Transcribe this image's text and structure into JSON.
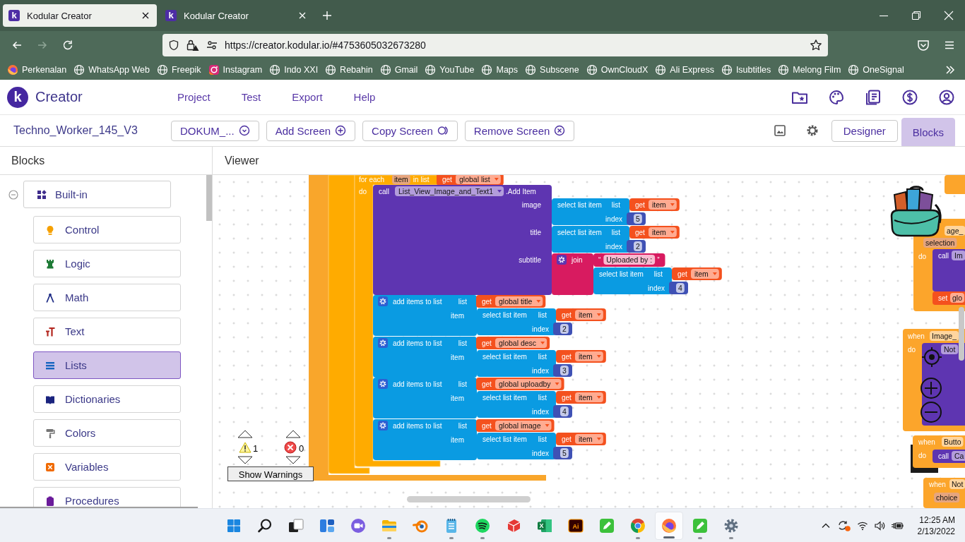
{
  "browser": {
    "tabs": [
      {
        "icon_letter": "k",
        "title": "Kodular Creator",
        "selected": true
      },
      {
        "icon_letter": "k",
        "title": "Kodular Creator",
        "selected": false
      }
    ],
    "url": "https://creator.kodular.io/#4753605032673280",
    "bookmarks": [
      {
        "label": "Perkenalan",
        "kind": "firefox"
      },
      {
        "label": "WhatsApp Web",
        "kind": "globe"
      },
      {
        "label": "Freepik",
        "kind": "globe"
      },
      {
        "label": "Instagram",
        "kind": "instagram"
      },
      {
        "label": "Indo XXI",
        "kind": "globe"
      },
      {
        "label": "Rebahin",
        "kind": "globe"
      },
      {
        "label": "Gmail",
        "kind": "globe"
      },
      {
        "label": "YouTube",
        "kind": "globe"
      },
      {
        "label": "Maps",
        "kind": "globe"
      },
      {
        "label": "Subscene",
        "kind": "globe"
      },
      {
        "label": "OwnCloudX",
        "kind": "globe"
      },
      {
        "label": "Ali Express",
        "kind": "globe"
      },
      {
        "label": "Isubtitles",
        "kind": "globe"
      },
      {
        "label": "Melong Film",
        "kind": "globe"
      },
      {
        "label": "OneSignal",
        "kind": "globe"
      }
    ]
  },
  "app": {
    "logo_letter": "k",
    "brand": "Creator",
    "menu": [
      "Project",
      "Test",
      "Export",
      "Help"
    ]
  },
  "toolbar": {
    "project": "Techno_Worker_145_V3",
    "screen": "DOKUM_...",
    "actions": [
      {
        "label": "Add Screen",
        "kind": "add"
      },
      {
        "label": "Copy Screen",
        "kind": "copy"
      },
      {
        "label": "Remove Screen",
        "kind": "remove"
      }
    ],
    "modes": [
      {
        "label": "Designer",
        "selected": false
      },
      {
        "label": "Blocks",
        "selected": true
      }
    ]
  },
  "blocks_panel": {
    "title": "Blocks",
    "tree": [
      {
        "label": "Built-in",
        "expanded": true,
        "selected": false,
        "children": [
          {
            "label": "Control",
            "kind": "control",
            "color": "#f5a000",
            "selected": false
          },
          {
            "label": "Logic",
            "kind": "logic",
            "color": "#1e7a36",
            "selected": false
          },
          {
            "label": "Math",
            "kind": "math",
            "color": "#1f2d86",
            "selected": false
          },
          {
            "label": "Text",
            "kind": "text",
            "color": "#b3261e",
            "selected": false
          },
          {
            "label": "Lists",
            "kind": "lists",
            "color": "#1565c0",
            "selected": true
          },
          {
            "label": "Dictionaries",
            "kind": "dictionaries",
            "color": "#1a237e",
            "selected": false
          },
          {
            "label": "Colors",
            "kind": "colors",
            "color": "#757575",
            "selected": false
          },
          {
            "label": "Variables",
            "kind": "variables",
            "color": "#f06a00",
            "selected": false
          },
          {
            "label": "Procedures",
            "kind": "procedures",
            "color": "#6a1b9a",
            "selected": false
          }
        ]
      }
    ]
  },
  "viewer": {
    "title": "Viewer",
    "for_each": {
      "label": "for each",
      "variable": "item",
      "in_list": "in list",
      "list": {
        "get": "get",
        "name": "global list"
      },
      "do": "do",
      "call": {
        "call": "call",
        "component": "List_View_Image_and_Text1",
        "method": ".Add Item",
        "args": [
          {
            "name": "image",
            "value": {
              "kind": "select",
              "label": "select list item",
              "list": "list",
              "get": "get",
              "var": "item",
              "index_label": "index",
              "index": "5"
            }
          },
          {
            "name": "title",
            "value": {
              "kind": "select",
              "label": "select list item",
              "list": "list",
              "get": "get",
              "var": "item",
              "index_label": "index",
              "index": "2"
            }
          },
          {
            "name": "subtitle",
            "value": {
              "kind": "join",
              "label": "join",
              "open_quote": "“",
              "text": "Uploaded by :",
              "close_quote": "”",
              "select": {
                "label": "select list item",
                "list": "list",
                "get": "get",
                "var": "item",
                "index_label": "index",
                "index": "4"
              }
            }
          }
        ]
      },
      "add_items": [
        {
          "label": "add items to list",
          "list_label": "list",
          "get": "get",
          "list": "global title",
          "item_label": "item",
          "select": {
            "label": "select list item",
            "list": "list",
            "get": "get",
            "var": "item",
            "index_label": "index",
            "index": "2"
          }
        },
        {
          "label": "add items to list",
          "list_label": "list",
          "get": "get",
          "list": "global desc",
          "item_label": "item",
          "select": {
            "label": "select list item",
            "list": "list",
            "get": "get",
            "var": "item",
            "index_label": "index",
            "index": "3"
          }
        },
        {
          "label": "add items to list",
          "list_label": "list",
          "get": "get",
          "list": "global uploadby",
          "item_label": "item",
          "select": {
            "label": "select list item",
            "list": "list",
            "get": "get",
            "var": "item",
            "index_label": "index",
            "index": "4"
          }
        },
        {
          "label": "add items to list",
          "list_label": "list",
          "get": "get",
          "list": "global image",
          "item_label": "item",
          "select": {
            "label": "select list item",
            "list": "list",
            "get": "get",
            "var": "item",
            "index_label": "index",
            "index": "5"
          }
        }
      ]
    },
    "side_blocks": [
      {
        "kind": "event",
        "component": "age_",
        "arg": "selection",
        "do": "do",
        "body": [
          {
            "kind": "call",
            "label": "call",
            "field": "Im"
          },
          {
            "kind": "set",
            "label": "set",
            "field": "glo"
          }
        ]
      },
      {
        "kind": "event",
        "when": "when",
        "component": "Image_",
        "do": "do",
        "body": [
          {
            "kind": "call",
            "field": "Not"
          }
        ]
      },
      {
        "kind": "event",
        "when": "when",
        "component": "Butto",
        "do": "do",
        "body": [
          {
            "kind": "call",
            "label": "call",
            "field": "Ca"
          }
        ]
      },
      {
        "kind": "event",
        "when": "when",
        "component": "Not",
        "arg": "choice"
      }
    ],
    "warnings": {
      "count": "1"
    },
    "errors": {
      "count": "0"
    },
    "show_warnings": "Show Warnings"
  },
  "taskbar": {
    "apps": [
      {
        "kind": "start",
        "running": false,
        "selected": false
      },
      {
        "kind": "search",
        "running": false,
        "selected": false
      },
      {
        "kind": "taskview",
        "running": false,
        "selected": false
      },
      {
        "kind": "widgets",
        "running": false,
        "selected": false
      },
      {
        "kind": "chat",
        "running": false,
        "selected": false
      },
      {
        "kind": "explorer",
        "running": true,
        "selected": false
      },
      {
        "kind": "blender",
        "running": false,
        "selected": false
      },
      {
        "kind": "notepad",
        "running": true,
        "selected": false
      },
      {
        "kind": "spotify",
        "running": true,
        "selected": false
      },
      {
        "kind": "sketchup",
        "running": false,
        "selected": false
      },
      {
        "kind": "excel",
        "glyph": "X",
        "running": false,
        "selected": false
      },
      {
        "kind": "illustrator",
        "glyph": "Ai",
        "running": false,
        "selected": false
      },
      {
        "kind": "pen",
        "running": false,
        "selected": false
      },
      {
        "kind": "chrome",
        "running": true,
        "selected": false
      },
      {
        "kind": "firefox",
        "running": true,
        "selected": true
      },
      {
        "kind": "pen",
        "running": true,
        "selected": false
      },
      {
        "kind": "settings",
        "running": true,
        "selected": false
      }
    ],
    "time": "12:25 AM",
    "date": "2/13/2022"
  }
}
